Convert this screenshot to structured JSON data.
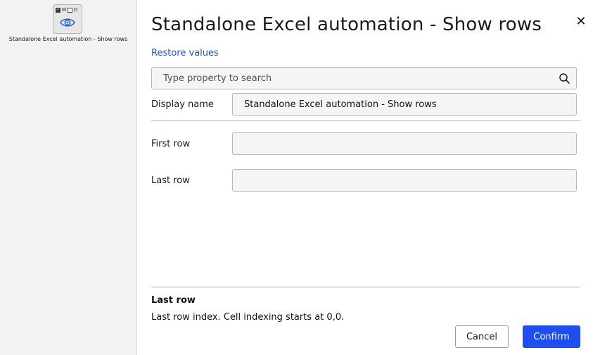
{
  "canvas": {
    "node": {
      "flag_m": "M",
      "flag_d": "D",
      "flag_m_checked": true,
      "flag_d_checked": false,
      "icon": "eye-icon",
      "label": "Standalone Excel automation - Show rows"
    }
  },
  "dialog": {
    "title": "Standalone Excel automation - Show rows",
    "close_icon": "close-icon",
    "restore_label": "Restore values",
    "search": {
      "placeholder": "Type property to search",
      "icon": "search-icon"
    },
    "fields": {
      "display_name_label": "Display name",
      "display_name_value": "Standalone Excel automation - Show rows",
      "first_row_label": "First row",
      "first_row_value": "",
      "last_row_label": "Last row",
      "last_row_value": ""
    },
    "help": {
      "title": "Last row",
      "text": "Last row index. Cell indexing starts at 0,0."
    },
    "buttons": {
      "cancel": "Cancel",
      "confirm": "Confirm"
    }
  },
  "colors": {
    "accent": "#1f4ef0",
    "link": "#2353d6",
    "node_icon": "#2d5fd3"
  }
}
